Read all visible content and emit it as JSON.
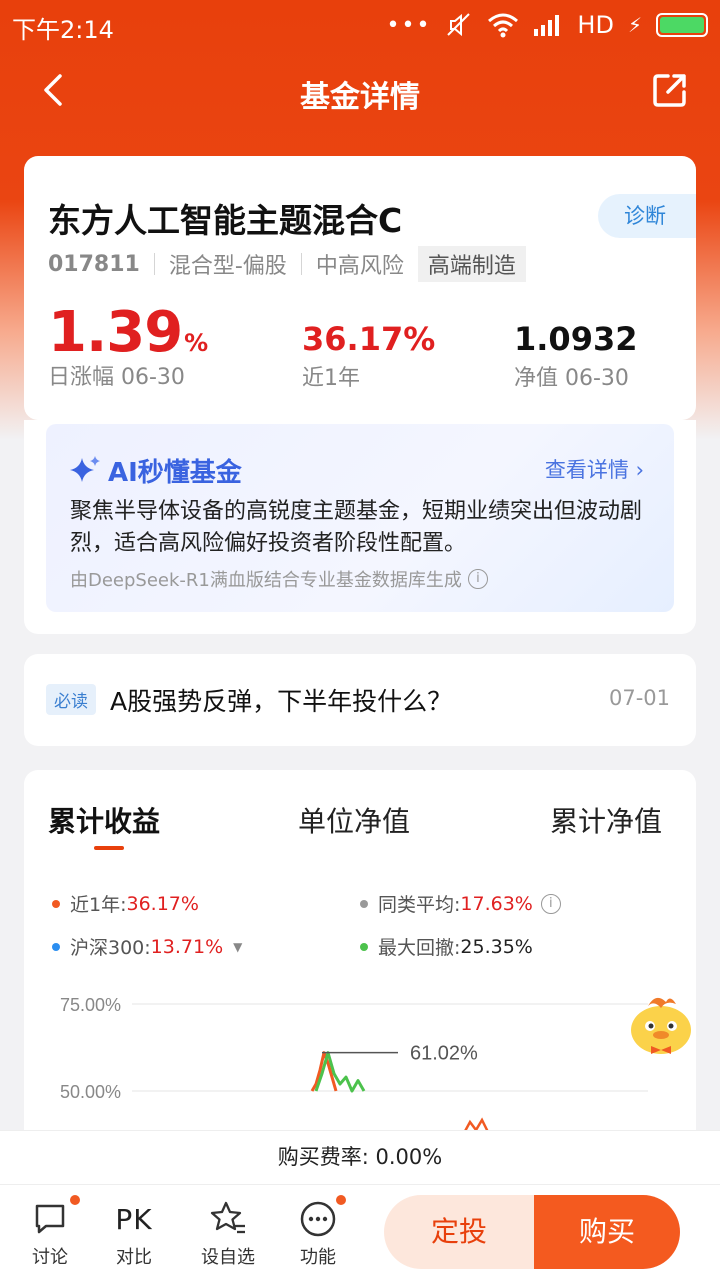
{
  "status_bar": {
    "time": "下午2:14",
    "network": "HD"
  },
  "nav": {
    "title": "基金详情"
  },
  "fund": {
    "name": "东方人工智能主题混合C",
    "diagnose_label": "诊断",
    "code": "017811",
    "type": "混合型-偏股",
    "risk": "中高风险",
    "tag": "高端制造",
    "daily_change": "1.39",
    "daily_change_unit": "%",
    "daily_change_label": "日涨幅 06-30",
    "year_return": "36.17%",
    "year_return_label": "近1年",
    "nav_value": "1.0932",
    "nav_label": "净值 06-30"
  },
  "ai": {
    "title": "AI秒懂基金",
    "more_label": "查看详情",
    "summary": "聚焦半导体设备的高锐度主题基金，短期业绩突出但波动剧烈，适合高风险偏好投资者阶段性配置。",
    "source": "由DeepSeek-R1满血版结合专业基金数据库生成"
  },
  "news": {
    "badge": "必读",
    "title": "A股强势反弹，下半年投什么？",
    "date": "07-01"
  },
  "chart_tabs": [
    "累计收益",
    "单位净值",
    "累计净值"
  ],
  "legend": {
    "fund": {
      "label": "近1年:",
      "value": "36.17%",
      "color": "#f15a22"
    },
    "peer": {
      "label": "同类平均:",
      "value": "17.63%",
      "color": "#999999"
    },
    "index": {
      "label": "沪深300:",
      "value": "13.71%",
      "color": "#2b8ef0"
    },
    "drawdown": {
      "label": "最大回撤:",
      "value": "25.35%",
      "color": "#4cc24c"
    }
  },
  "chart_data": {
    "type": "line",
    "y_ticks": [
      "75.00%",
      "50.00%"
    ],
    "ylim": [
      50,
      75
    ],
    "annotation": "61.02%",
    "series": [
      {
        "color": "#f15a22",
        "values": [
          50,
          52,
          56,
          61.02,
          58,
          54,
          50
        ]
      },
      {
        "color": "#4cc24c",
        "values": [
          50,
          55,
          61.02,
          55,
          52,
          54,
          50,
          53,
          50
        ]
      }
    ]
  },
  "fee": {
    "text": "购买费率: 0.00%"
  },
  "bottom_nav": {
    "discuss": "讨论",
    "compare_icon": "PK",
    "compare": "对比",
    "watch": "设自选",
    "functions": "功能",
    "dingtou": "定投",
    "buy": "购买"
  }
}
